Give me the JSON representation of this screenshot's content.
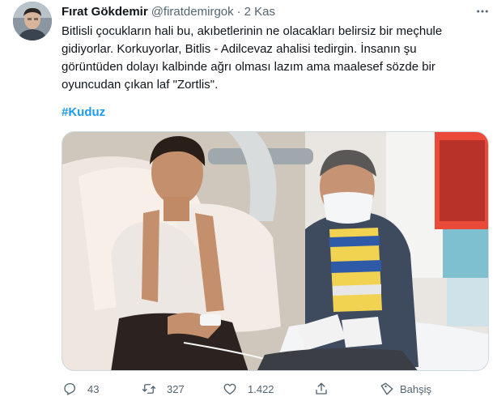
{
  "tweet": {
    "author": {
      "name": "Fırat Gökdemir",
      "handle": "@firatdemirgok",
      "separator": "·",
      "time": "2 Kas"
    },
    "text": "Bitlisli çocukların hali bu, akıbetlerinin ne olacakları belirsiz bir meçhule\ngidiyorlar. Korkuyorlar, Bitlis - Adilcevaz ahalisi tedirgin. İnsanın şu\ngörüntüden dolayı kalbinde ağrı olması lazım ama maalesef sözde bir\noyuncudan çıkan laf \"Zortlis\".",
    "hashtag": "#Kuduz",
    "more_icon": "more-horizontal-icon",
    "actions": {
      "reply": {
        "icon": "reply-icon",
        "count": "43"
      },
      "retweet": {
        "icon": "retweet-icon",
        "count": "327"
      },
      "like": {
        "icon": "heart-icon",
        "count": "1.422"
      },
      "share": {
        "icon": "share-icon"
      },
      "tip": {
        "icon": "tip-icon",
        "label": "Bahşiş"
      }
    }
  },
  "colors": {
    "text": "#0f1419",
    "muted": "#536471",
    "link": "#1d9bf0",
    "border": "#cfd9de"
  }
}
